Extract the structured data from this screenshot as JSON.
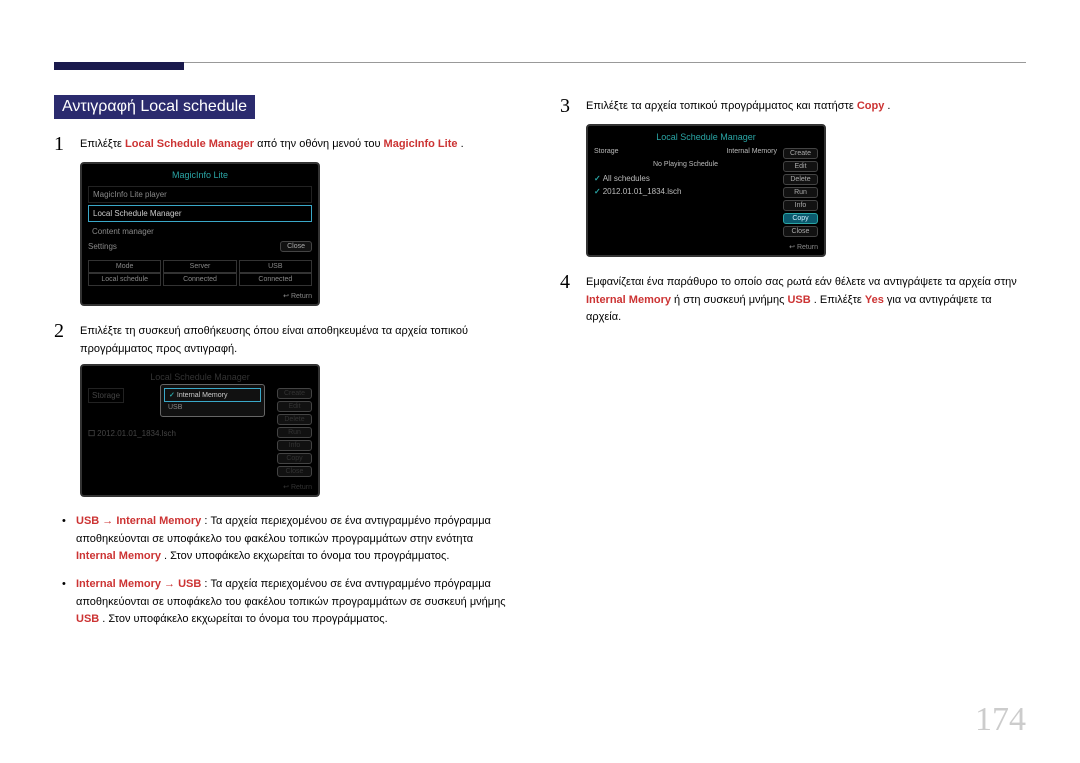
{
  "page_number": "174",
  "section_title": "Αντιγραφή Local schedule",
  "step1_num": "1",
  "step1a": "Επιλέξτε ",
  "step1b": "Local Schedule Manager",
  "step1c": " από την οθόνη μενού του ",
  "step1d": "MagicInfo Lite",
  "step1e": ".",
  "ui1_title": "MagicInfo Lite",
  "ui1_items": [
    "MagicInfo Lite player",
    "Local Schedule Manager",
    "Content manager",
    "Settings"
  ],
  "ui1_close": "Close",
  "ui1_cells": [
    [
      "Mode",
      "Server",
      "USB"
    ],
    [
      "Local schedule",
      "Connected",
      "Connected"
    ]
  ],
  "ui1_return": "Return",
  "step2_num": "2",
  "step2_text": "Επιλέξτε τη συσκευή αποθήκευσης όπου είναι αποθηκευμένα τα αρχεία τοπικού προγράμματος προς αντιγραφή.",
  "ui2_title": "Local Schedule Manager",
  "ui2_storage": "Storage",
  "ui2_filenm": "2012.01.01_1834.lsch",
  "ui2_side": [
    "Create",
    "Edit",
    "Delete",
    "Run",
    "Info",
    "Copy",
    "Close"
  ],
  "ui2_return": "Return",
  "ui2_popup_a": "Internal Memory",
  "ui2_popup_b": "USB",
  "bullet1_a": "USB → Internal Memory",
  "bullet1_b": ": Τα αρχεία περιεχομένου σε ένα αντιγραμμένο πρόγραμμα αποθηκεύονται σε υποφάκελο του φακέλου τοπικών προγραμμάτων στην ενότητα ",
  "bullet1_c": "Internal Memory",
  "bullet1_d": ". Στον υποφάκελο εκχωρείται το όνομα του προγράμματος.",
  "bullet2_a": "Internal Memory → USB",
  "bullet2_b": ": Τα αρχεία περιεχομένου σε ένα αντιγραμμένο πρόγραμμα αποθηκεύονται σε υποφάκελο του φακέλου τοπικών προγραμμάτων σε συσκευή μνήμης ",
  "bullet2_c": "USB",
  "bullet2_d": ". Στον υποφάκελο εκχωρείται το όνομα του προγράμματος.",
  "step3_num": "3",
  "step3a": "Επιλέξτε τα αρχεία τοπικού προγράμματος και πατήστε ",
  "step3b": "Copy",
  "step3c": ".",
  "ui3_title": "Local Schedule Manager",
  "ui3_storage_lbl": "Storage",
  "ui3_storage_val": "Internal Memory",
  "ui3_noplay": "No Playing Schedule",
  "ui3_allsched": "All schedules",
  "ui3_file": "2012.01.01_1834.lsch",
  "ui3_side": [
    "Create",
    "Edit",
    "Delete",
    "Run",
    "Info",
    "Copy",
    "Close"
  ],
  "ui3_return": "Return",
  "step4_num": "4",
  "step4a": "Εμφανίζεται ένα παράθυρο το οποίο σας ρωτά εάν θέλετε να αντιγράψετε τα αρχεία στην ",
  "step4b": "Internal Memory",
  "step4c": " ή στη συσκευή μνήμης ",
  "step4d": "USB",
  "step4e": ". Επιλέξτε ",
  "step4f": "Yes",
  "step4g": " για να αντιγράψετε τα αρχεία."
}
